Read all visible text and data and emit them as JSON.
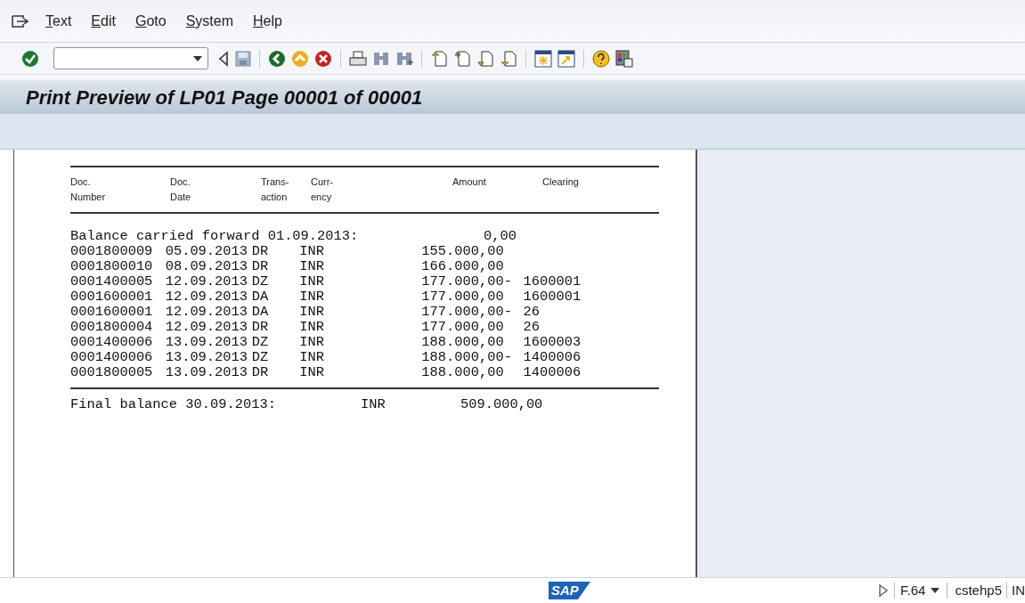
{
  "menu": [
    {
      "label": "Text"
    },
    {
      "label": "Edit"
    },
    {
      "label": "Goto"
    },
    {
      "label": "System"
    },
    {
      "label": "Help"
    }
  ],
  "title": "Print Preview of LP01 Page 00001 of 00001",
  "report": {
    "columns": [
      {
        "lines": [
          "Doc.",
          "Number"
        ]
      },
      {
        "lines": [
          "Doc.",
          "Date"
        ]
      },
      {
        "lines": [
          "Trans-",
          "action"
        ]
      },
      {
        "lines": [
          "Curr-",
          "ency"
        ]
      },
      {
        "lines": [
          "Amount"
        ]
      },
      {
        "lines": [
          "Clearing"
        ]
      }
    ],
    "opening": {
      "label": "Balance carried forward 01.09.2013:",
      "amount": "0,00"
    },
    "rows": [
      {
        "doc_number": "0001800009",
        "doc_date": "05.09.2013",
        "transaction": "DR",
        "currency": "INR",
        "amount": "155.000,00",
        "clearing": ""
      },
      {
        "doc_number": "0001800010",
        "doc_date": "08.09.2013",
        "transaction": "DR",
        "currency": "INR",
        "amount": "166.000,00",
        "clearing": ""
      },
      {
        "doc_number": "0001400005",
        "doc_date": "12.09.2013",
        "transaction": "DZ",
        "currency": "INR",
        "amount": "177.000,00-",
        "clearing": "1600001"
      },
      {
        "doc_number": "0001600001",
        "doc_date": "12.09.2013",
        "transaction": "DA",
        "currency": "INR",
        "amount": "177.000,00",
        "clearing": "1600001"
      },
      {
        "doc_number": "0001600001",
        "doc_date": "12.09.2013",
        "transaction": "DA",
        "currency": "INR",
        "amount": "177.000,00-",
        "clearing": "26"
      },
      {
        "doc_number": "0001800004",
        "doc_date": "12.09.2013",
        "transaction": "DR",
        "currency": "INR",
        "amount": "177.000,00",
        "clearing": "26"
      },
      {
        "doc_number": "0001400006",
        "doc_date": "13.09.2013",
        "transaction": "DZ",
        "currency": "INR",
        "amount": "188.000,00",
        "clearing": "1600003"
      },
      {
        "doc_number": "0001400006",
        "doc_date": "13.09.2013",
        "transaction": "DZ",
        "currency": "INR",
        "amount": "188.000,00-",
        "clearing": "1400006"
      },
      {
        "doc_number": "0001800005",
        "doc_date": "13.09.2013",
        "transaction": "DR",
        "currency": "INR",
        "amount": "188.000,00",
        "clearing": "1400006"
      }
    ],
    "final": {
      "label": "Final balance 30.09.2013:",
      "currency": "INR",
      "amount": "509.000,00"
    }
  },
  "status_bar": {
    "logo": "SAP",
    "transaction": "F.64",
    "server": "cstehp5",
    "mode": "IN"
  }
}
